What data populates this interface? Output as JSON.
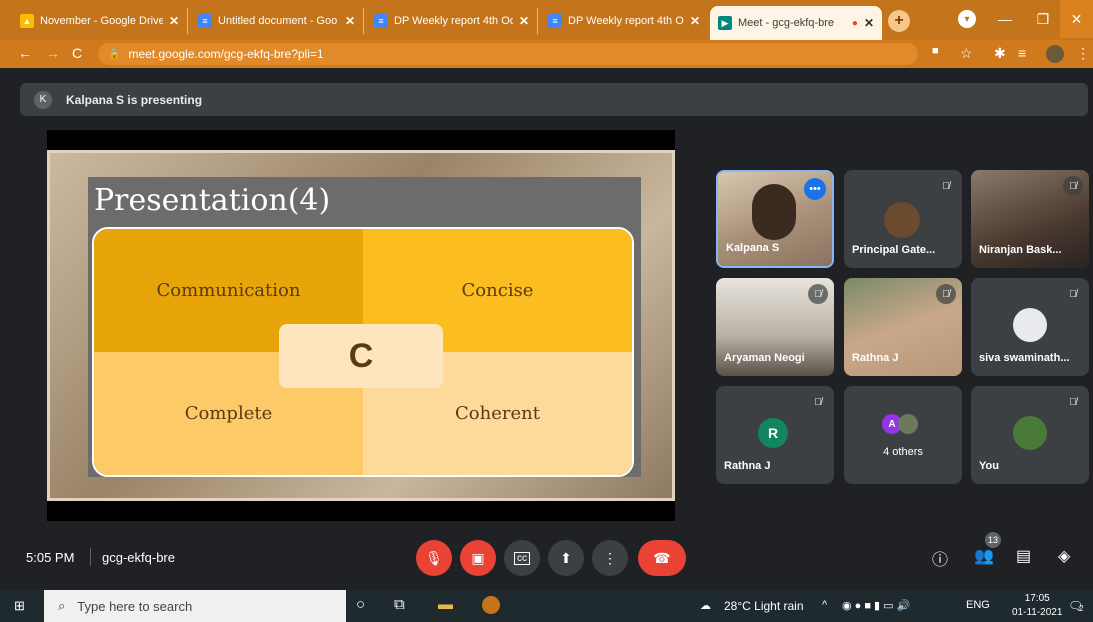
{
  "browser": {
    "tabs": [
      {
        "title": "November - Google Drive",
        "icon": "drive-icon",
        "color": "#fbbc04"
      },
      {
        "title": "Untitled document - Goo",
        "icon": "docs-icon",
        "color": "#4285f4"
      },
      {
        "title": "DP Weekly report 4th Oct",
        "icon": "docs-icon",
        "color": "#4285f4"
      },
      {
        "title": "DP Weekly report 4th Oct",
        "icon": "docs-icon",
        "color": "#4285f4"
      },
      {
        "title": "Meet - gcg-ekfq-bre",
        "icon": "meet-icon",
        "color": "#00897b",
        "active": true
      }
    ],
    "url": "meet.google.com/gcg-ekfq-bre?pli=1",
    "accent": "#c4741a"
  },
  "meet": {
    "presenting_banner": "Kalpana S is presenting",
    "presenter_initial": "K",
    "slide": {
      "title": "Presentation(4)",
      "center": "C",
      "quadrants": [
        "Communication",
        "Concise",
        "Complete",
        "Coherent"
      ]
    },
    "participants": [
      {
        "name": "Kalpana S",
        "speaking": true
      },
      {
        "name": "Principal Gate..."
      },
      {
        "name": "Niranjan Bask..."
      },
      {
        "name": "Aryaman Neogi"
      },
      {
        "name": "Rathna J"
      },
      {
        "name": "siva swaminath..."
      },
      {
        "name": "Rathna J",
        "initial": "R"
      },
      {
        "name": "4 others",
        "initial": "A"
      },
      {
        "name": "You"
      }
    ],
    "time": "5:05 PM",
    "meeting_code": "gcg-ekfq-bre",
    "people_count": "13"
  },
  "taskbar": {
    "search_placeholder": "Type here to search",
    "weather": "28°C  Light rain",
    "language": "ENG",
    "clock_time": "17:05",
    "clock_date": "01-11-2021",
    "notifications": "2"
  }
}
